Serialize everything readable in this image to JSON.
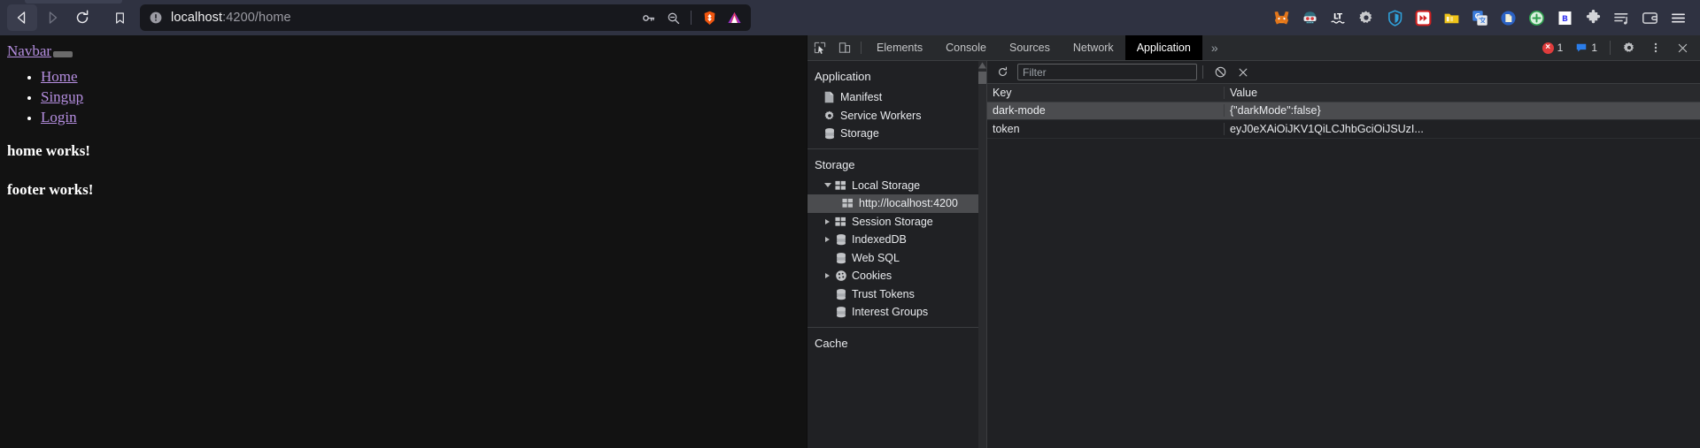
{
  "browser": {
    "back_label": "Back",
    "forward_label": "Forward",
    "reload_label": "Reload",
    "bookmark_label": "Bookmark this page",
    "url_host": "localhost",
    "url_path": ":4200/home",
    "site_info_label": "Not secure",
    "omnibox_icons": [
      "password-key-icon",
      "zoom-out-icon",
      "brave-shields-icon",
      "brave-rewards-icon"
    ],
    "extensions": [
      "metamask-icon",
      "snorkel-goggles-icon",
      "languagetool-icon",
      "gear-extension-icon",
      "zenmate-shield-icon",
      "fast-forward-icon",
      "folder-icon",
      "google-translate-icon",
      "blue-document-icon",
      "green-plus-icon",
      "bitwarden-icon",
      "puzzle-extensions-icon",
      "playlist-music-icon",
      "wallet-icon",
      "browser-menu-icon"
    ]
  },
  "page": {
    "navbar_link": "Navbar",
    "nav_items": [
      {
        "label": "Home"
      },
      {
        "label": "Singup"
      },
      {
        "label": "Login"
      }
    ],
    "home_text": "home works!",
    "footer_text": "footer works!",
    "link_color": "#b58ee0",
    "bg_color": "#121212"
  },
  "devtools": {
    "tabs": [
      {
        "label": "Elements",
        "selected": false
      },
      {
        "label": "Console",
        "selected": false
      },
      {
        "label": "Sources",
        "selected": false
      },
      {
        "label": "Network",
        "selected": false
      },
      {
        "label": "Application",
        "selected": true
      }
    ],
    "overflow_label": "»",
    "error_count": "1",
    "message_count": "1",
    "settings_label": "Settings",
    "more_label": "More options",
    "close_label": "Close DevTools",
    "sidebar": {
      "application_title": "Application",
      "application_items": [
        {
          "label": "Manifest",
          "icon": "document-icon"
        },
        {
          "label": "Service Workers",
          "icon": "gear-icon"
        },
        {
          "label": "Storage",
          "icon": "database-icon"
        }
      ],
      "storage_title": "Storage",
      "storage_items": [
        {
          "label": "Local Storage",
          "icon": "table-icon",
          "expanded": true,
          "selected": false,
          "indent": 0
        },
        {
          "label": "http://localhost:4200",
          "icon": "table-icon",
          "expanded": null,
          "selected": true,
          "indent": 2
        },
        {
          "label": "Session Storage",
          "icon": "table-icon",
          "expanded": false,
          "selected": false,
          "indent": 0
        },
        {
          "label": "IndexedDB",
          "icon": "database-icon",
          "expanded": false,
          "selected": false,
          "indent": 0
        },
        {
          "label": "Web SQL",
          "icon": "database-icon",
          "expanded": null,
          "selected": false,
          "indent": 1
        },
        {
          "label": "Cookies",
          "icon": "cookie-icon",
          "expanded": false,
          "selected": false,
          "indent": 0
        },
        {
          "label": "Trust Tokens",
          "icon": "database-icon",
          "expanded": null,
          "selected": false,
          "indent": 1
        },
        {
          "label": "Interest Groups",
          "icon": "database-icon",
          "expanded": null,
          "selected": false,
          "indent": 1
        }
      ],
      "cache_title": "Cache"
    },
    "toolbar": {
      "refresh_label": "Refresh",
      "filter_placeholder": "Filter",
      "filter_value": "",
      "clear_all_label": "Clear all",
      "delete_selected_label": "Delete selected"
    },
    "table": {
      "columns": [
        "Key",
        "Value"
      ],
      "rows": [
        {
          "key": "dark-mode",
          "value": "{\"darkMode\":false}",
          "selected": true
        },
        {
          "key": "token",
          "value": "eyJ0eXAiOiJKV1QiLCJhbGciOiJSUzI...",
          "selected": false
        }
      ]
    }
  }
}
